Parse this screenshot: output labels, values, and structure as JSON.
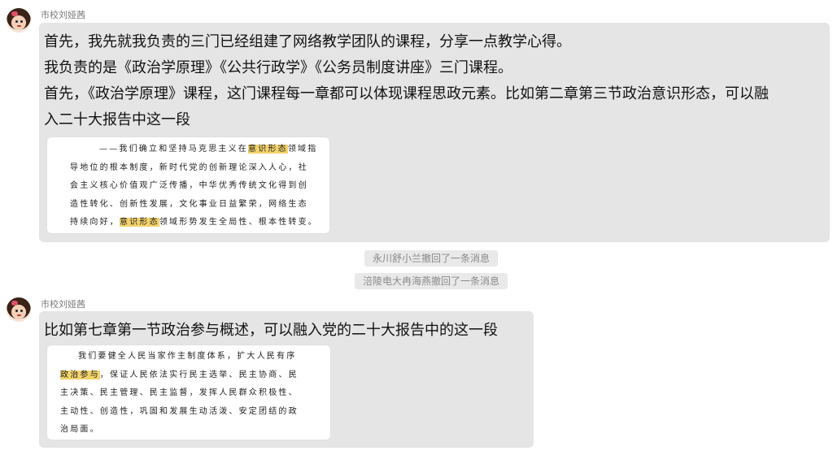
{
  "messages": [
    {
      "sender": "市校刘娅茜",
      "lines": [
        "首先，我先就我负责的三门已经组建了网络教学团队的课程，分享一点教学心得。",
        "我负责的是《政治学原理》《公共行政学》《公务员制度讲座》三门课程。",
        "首先，《政治学原理》课程，这门课程每一章都可以体现课程思政元素。比如第二章第三节政治意识形态，可以融",
        "入二十大报告中这一段"
      ],
      "quote": {
        "lines": [
          {
            "pre": "——我们确立和坚持马克思主义在",
            "hl": "意识形态",
            "post": "领域指"
          },
          {
            "pre": "导地位的根本制度，新时代党的创新理论深入人心，社",
            "hl": "",
            "post": ""
          },
          {
            "pre": "会主义核心价值观广泛传播，中华优秀传统文化得到创",
            "hl": "",
            "post": ""
          },
          {
            "pre": "造性转化、创新性发展，文化事业日益繁荣，网络生态",
            "hl": "",
            "post": ""
          },
          {
            "pre": "持续向好，",
            "hl": "意识形态",
            "post": "领域形势发生全局性、根本性转变。"
          }
        ]
      }
    },
    {
      "sender": "市校刘娅茜",
      "lines": [
        "比如第七章第一节政治参与概述，可以融入党的二十大报告中的这一段"
      ],
      "quote": {
        "lines": [
          {
            "pre": "我们要健全人民当家作主制度体系，扩大人民有序",
            "hl": "",
            "post": ""
          },
          {
            "pre": "",
            "hl": "政治参与",
            "post": "，保证人民依法实行民主选举、民主协商、民"
          },
          {
            "pre": "主决策、民主管理、民主监督，发挥人民群众积极性、",
            "hl": "",
            "post": ""
          },
          {
            "pre": "主动性、创造性，巩固和发展生动活泼、安定团结的政",
            "hl": "",
            "post": ""
          },
          {
            "pre": "治局面。",
            "hl": "",
            "post": ""
          }
        ]
      }
    }
  ],
  "system_notices": [
    "永川舒小兰撤回了一条消息",
    "涪陵电大冉海燕撤回了一条消息"
  ],
  "colors": {
    "bubble": "#e5e5e5",
    "highlight": "#f4d36b",
    "system_bg": "#e9e9e9"
  }
}
